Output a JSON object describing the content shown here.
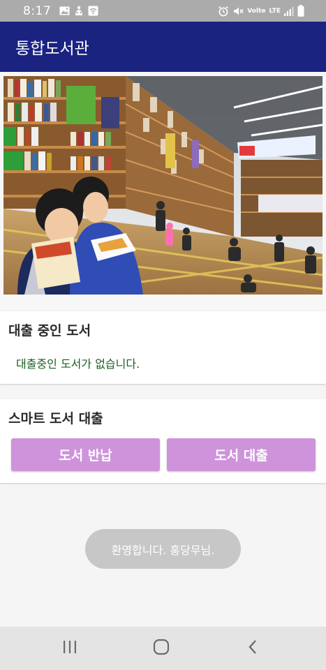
{
  "status_bar": {
    "time": "8:17",
    "volte": "Volte",
    "network": "LTE"
  },
  "app_bar": {
    "title": "통합도서관"
  },
  "hero": {
    "image": "library-photo-children-reading"
  },
  "loans_section": {
    "title": "대출 중인 도서",
    "empty_message": "대출중인 도서가 없습니다."
  },
  "smart_section": {
    "title": "스마트 도서 대출",
    "return_button": "도서 반납",
    "borrow_button": "도서 대출"
  },
  "toast": {
    "message": "환영합니다. 홍당무님."
  },
  "nav_bar": {
    "recents_icon": "recents-icon",
    "home_icon": "home-icon",
    "back_icon": "back-icon"
  },
  "colors": {
    "status_bar": "#ababab",
    "app_bar": "#1a2380",
    "button": "#cf93dc",
    "empty_text": "#1b5e20",
    "toast": "#c7c7c7",
    "nav_bar": "#e4e4e4"
  }
}
